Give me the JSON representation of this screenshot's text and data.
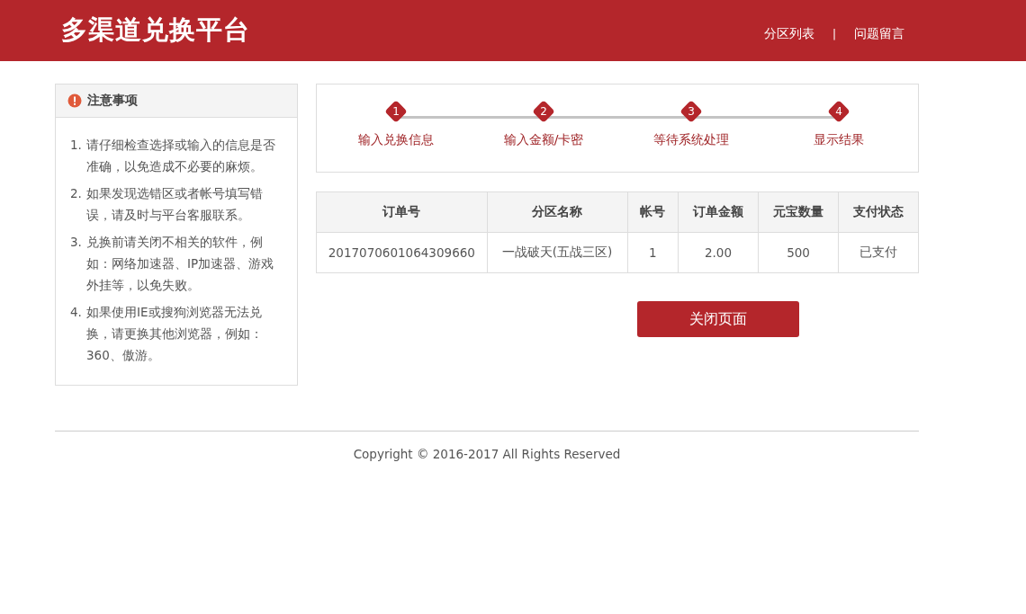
{
  "header": {
    "title": "多渠道兑换平台",
    "nav": [
      "分区列表",
      "问题留言"
    ],
    "separator": "|"
  },
  "notice": {
    "title": "注意事项",
    "items": [
      {
        "number": "1.",
        "text": "请仔细检查选择或输入的信息是否准确，以免造成不必要的麻烦。"
      },
      {
        "number": "2.",
        "text": "如果发现选错区或者帐号填写错误，请及时与平台客服联系。"
      },
      {
        "number": "3.",
        "text": "兑换前请关闭不相关的软件，例如：网络加速器、IP加速器、游戏外挂等，以免失败。"
      },
      {
        "number": "4.",
        "text": "如果使用IE或搜狗浏览器无法兑换，请更换其他浏览器，例如：360、傲游。"
      }
    ]
  },
  "steps": [
    {
      "number": "1",
      "label": "输入兑换信息"
    },
    {
      "number": "2",
      "label": "输入金额/卡密"
    },
    {
      "number": "3",
      "label": "等待系统处理"
    },
    {
      "number": "4",
      "label": "显示结果"
    }
  ],
  "table": {
    "columns": [
      "订单号",
      "分区名称",
      "帐号",
      "订单金额",
      "元宝数量",
      "支付状态"
    ],
    "rows": [
      [
        "2017070601064309660",
        "一战破天(五战三区)",
        "1",
        "2.00",
        "500",
        "已支付"
      ]
    ]
  },
  "close_button": "关闭页面",
  "footer": "Copyright © 2016-2017 All Rights Reserved"
}
